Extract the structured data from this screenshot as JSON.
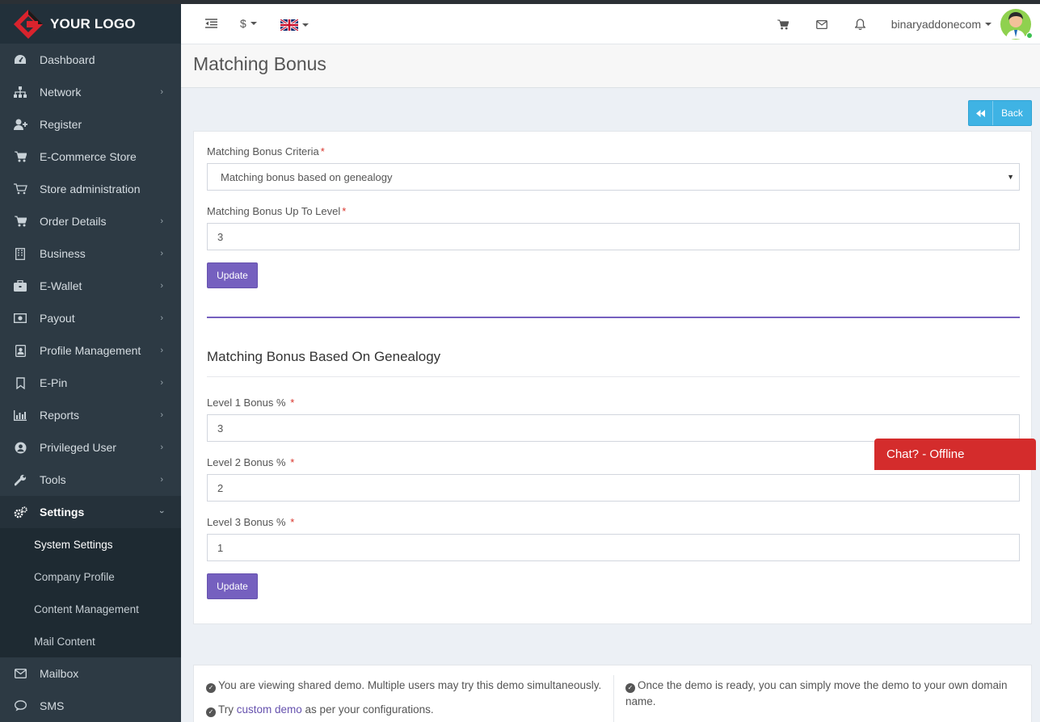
{
  "brand": {
    "logo_text": "YOUR LOGO"
  },
  "sidebar": {
    "items": [
      {
        "label": "Dashboard",
        "icon": "dashboard-icon",
        "has_children": false
      },
      {
        "label": "Network",
        "icon": "sitemap-icon",
        "has_children": true
      },
      {
        "label": "Register",
        "icon": "user-plus-icon",
        "has_children": false
      },
      {
        "label": "E-Commerce Store",
        "icon": "cart-icon",
        "has_children": false
      },
      {
        "label": "Store administration",
        "icon": "cart-outline-icon",
        "has_children": false
      },
      {
        "label": "Order Details",
        "icon": "cart-icon",
        "has_children": true
      },
      {
        "label": "Business",
        "icon": "building-icon",
        "has_children": true
      },
      {
        "label": "E-Wallet",
        "icon": "briefcase-icon",
        "has_children": true
      },
      {
        "label": "Payout",
        "icon": "money-icon",
        "has_children": true
      },
      {
        "label": "Profile Management",
        "icon": "id-card-icon",
        "has_children": true
      },
      {
        "label": "E-Pin",
        "icon": "bookmark-icon",
        "has_children": true
      },
      {
        "label": "Reports",
        "icon": "bar-chart-icon",
        "has_children": true
      },
      {
        "label": "Privileged User",
        "icon": "user-circle-icon",
        "has_children": true
      },
      {
        "label": "Tools",
        "icon": "wrench-icon",
        "has_children": true
      },
      {
        "label": "Settings",
        "icon": "gears-icon",
        "has_children": true,
        "expanded": true
      }
    ],
    "settings_submenu": [
      "System Settings",
      "Company Profile",
      "Content Management",
      "Mail Content"
    ],
    "after_items": [
      {
        "label": "Mailbox",
        "icon": "envelope-icon"
      },
      {
        "label": "SMS",
        "icon": "comment-icon"
      }
    ]
  },
  "header": {
    "currency": "$",
    "language_flag": "uk-flag-icon",
    "username": "binaryaddonecom"
  },
  "page": {
    "title": "Matching Bonus",
    "back_label": "Back"
  },
  "form": {
    "criteria_label": "Matching Bonus Criteria",
    "criteria_value": "Matching bonus based on genealogy",
    "upto_label": "Matching Bonus Up To Level",
    "upto_value": "3",
    "update_label": "Update",
    "required_mark": "*"
  },
  "genealogy": {
    "section_title": "Matching Bonus Based On Genealogy",
    "levels": [
      {
        "label": "Level 1 Bonus %",
        "value": "3"
      },
      {
        "label": "Level 2 Bonus %",
        "value": "2"
      },
      {
        "label": "Level 3 Bonus %",
        "value": "1"
      }
    ],
    "update_label": "Update"
  },
  "chat": {
    "label": "Chat? - Offline"
  },
  "footer": {
    "note1": "You are viewing shared demo. Multiple users may try this demo simultaneously.",
    "note2_pre": "Try ",
    "note2_link": "custom demo",
    "note2_post": " as per your configurations.",
    "note3": "Once the demo is ready, you can simply move the demo to your own domain name."
  },
  "colors": {
    "sidebar_bg": "#2d3a44",
    "accent_purple": "#7560bf",
    "back_blue": "#3fb3e4",
    "chat_red": "#d42c2c"
  }
}
